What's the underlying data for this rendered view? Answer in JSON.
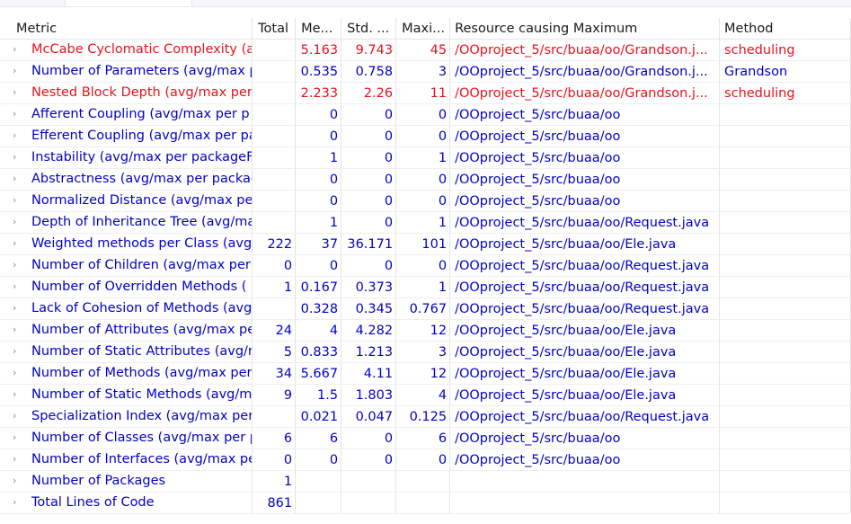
{
  "columns": {
    "metric": "Metric",
    "total": "Total",
    "mean": "Me...",
    "std": "Std. ...",
    "max": "Maxi...",
    "resource": "Resource causing Maximum",
    "method": "Method"
  },
  "colors": {
    "normal_text": "#0000c8",
    "warning_text": "#e8121c"
  },
  "rows": [
    {
      "metric": "McCabe Cyclomatic Complexity (av",
      "total": "",
      "mean": "5.163",
      "std": "9.743",
      "max": "45",
      "resource": "/OOproject_5/src/buaa/oo/Grandson.j...",
      "method": "scheduling",
      "warning": true
    },
    {
      "metric": "Number of Parameters (avg/max p",
      "total": "",
      "mean": "0.535",
      "std": "0.758",
      "max": "3",
      "resource": "/OOproject_5/src/buaa/oo/Grandson.j...",
      "method": "Grandson",
      "warning": false
    },
    {
      "metric": "Nested Block Depth (avg/max per",
      "total": "",
      "mean": "2.233",
      "std": "2.26",
      "max": "11",
      "resource": "/OOproject_5/src/buaa/oo/Grandson.j...",
      "method": "scheduling",
      "warning": true
    },
    {
      "metric": "Afferent Coupling (avg/max per p",
      "total": "",
      "mean": "0",
      "std": "0",
      "max": "0",
      "resource": "/OOproject_5/src/buaa/oo",
      "method": "",
      "warning": false
    },
    {
      "metric": "Efferent Coupling (avg/max per pa",
      "total": "",
      "mean": "0",
      "std": "0",
      "max": "0",
      "resource": "/OOproject_5/src/buaa/oo",
      "method": "",
      "warning": false
    },
    {
      "metric": "Instability (avg/max per packageFr",
      "total": "",
      "mean": "1",
      "std": "0",
      "max": "1",
      "resource": "/OOproject_5/src/buaa/oo",
      "method": "",
      "warning": false
    },
    {
      "metric": "Abstractness (avg/max per packag",
      "total": "",
      "mean": "0",
      "std": "0",
      "max": "0",
      "resource": "/OOproject_5/src/buaa/oo",
      "method": "",
      "warning": false
    },
    {
      "metric": "Normalized Distance (avg/max pe",
      "total": "",
      "mean": "0",
      "std": "0",
      "max": "0",
      "resource": "/OOproject_5/src/buaa/oo",
      "method": "",
      "warning": false
    },
    {
      "metric": "Depth of Inheritance Tree (avg/ma",
      "total": "",
      "mean": "1",
      "std": "0",
      "max": "1",
      "resource": "/OOproject_5/src/buaa/oo/Request.java",
      "method": "",
      "warning": false
    },
    {
      "metric": "Weighted methods per Class (avg",
      "total": "222",
      "mean": "37",
      "std": "36.171",
      "max": "101",
      "resource": "/OOproject_5/src/buaa/oo/Ele.java",
      "method": "",
      "warning": false
    },
    {
      "metric": "Number of Children (avg/max per",
      "total": "0",
      "mean": "0",
      "std": "0",
      "max": "0",
      "resource": "/OOproject_5/src/buaa/oo/Request.java",
      "method": "",
      "warning": false
    },
    {
      "metric": "Number of Overridden Methods (",
      "total": "1",
      "mean": "0.167",
      "std": "0.373",
      "max": "1",
      "resource": "/OOproject_5/src/buaa/oo/Request.java",
      "method": "",
      "warning": false
    },
    {
      "metric": "Lack of Cohesion of Methods (avg",
      "total": "",
      "mean": "0.328",
      "std": "0.345",
      "max": "0.767",
      "resource": "/OOproject_5/src/buaa/oo/Request.java",
      "method": "",
      "warning": false
    },
    {
      "metric": "Number of Attributes (avg/max pe",
      "total": "24",
      "mean": "4",
      "std": "4.282",
      "max": "12",
      "resource": "/OOproject_5/src/buaa/oo/Ele.java",
      "method": "",
      "warning": false
    },
    {
      "metric": "Number of Static Attributes (avg/r",
      "total": "5",
      "mean": "0.833",
      "std": "1.213",
      "max": "3",
      "resource": "/OOproject_5/src/buaa/oo/Ele.java",
      "method": "",
      "warning": false
    },
    {
      "metric": "Number of Methods (avg/max per",
      "total": "34",
      "mean": "5.667",
      "std": "4.11",
      "max": "12",
      "resource": "/OOproject_5/src/buaa/oo/Ele.java",
      "method": "",
      "warning": false
    },
    {
      "metric": "Number of Static Methods (avg/m",
      "total": "9",
      "mean": "1.5",
      "std": "1.803",
      "max": "4",
      "resource": "/OOproject_5/src/buaa/oo/Ele.java",
      "method": "",
      "warning": false
    },
    {
      "metric": "Specialization Index (avg/max per",
      "total": "",
      "mean": "0.021",
      "std": "0.047",
      "max": "0.125",
      "resource": "/OOproject_5/src/buaa/oo/Request.java",
      "method": "",
      "warning": false
    },
    {
      "metric": "Number of Classes (avg/max per p",
      "total": "6",
      "mean": "6",
      "std": "0",
      "max": "6",
      "resource": "/OOproject_5/src/buaa/oo",
      "method": "",
      "warning": false
    },
    {
      "metric": "Number of Interfaces (avg/max pe",
      "total": "0",
      "mean": "0",
      "std": "0",
      "max": "0",
      "resource": "/OOproject_5/src/buaa/oo",
      "method": "",
      "warning": false
    },
    {
      "metric": "Number of Packages",
      "total": "1",
      "mean": "",
      "std": "",
      "max": "",
      "resource": "",
      "method": "",
      "warning": false
    },
    {
      "metric": "Total Lines of Code",
      "total": "861",
      "mean": "",
      "std": "",
      "max": "",
      "resource": "",
      "method": "",
      "warning": false
    }
  ]
}
